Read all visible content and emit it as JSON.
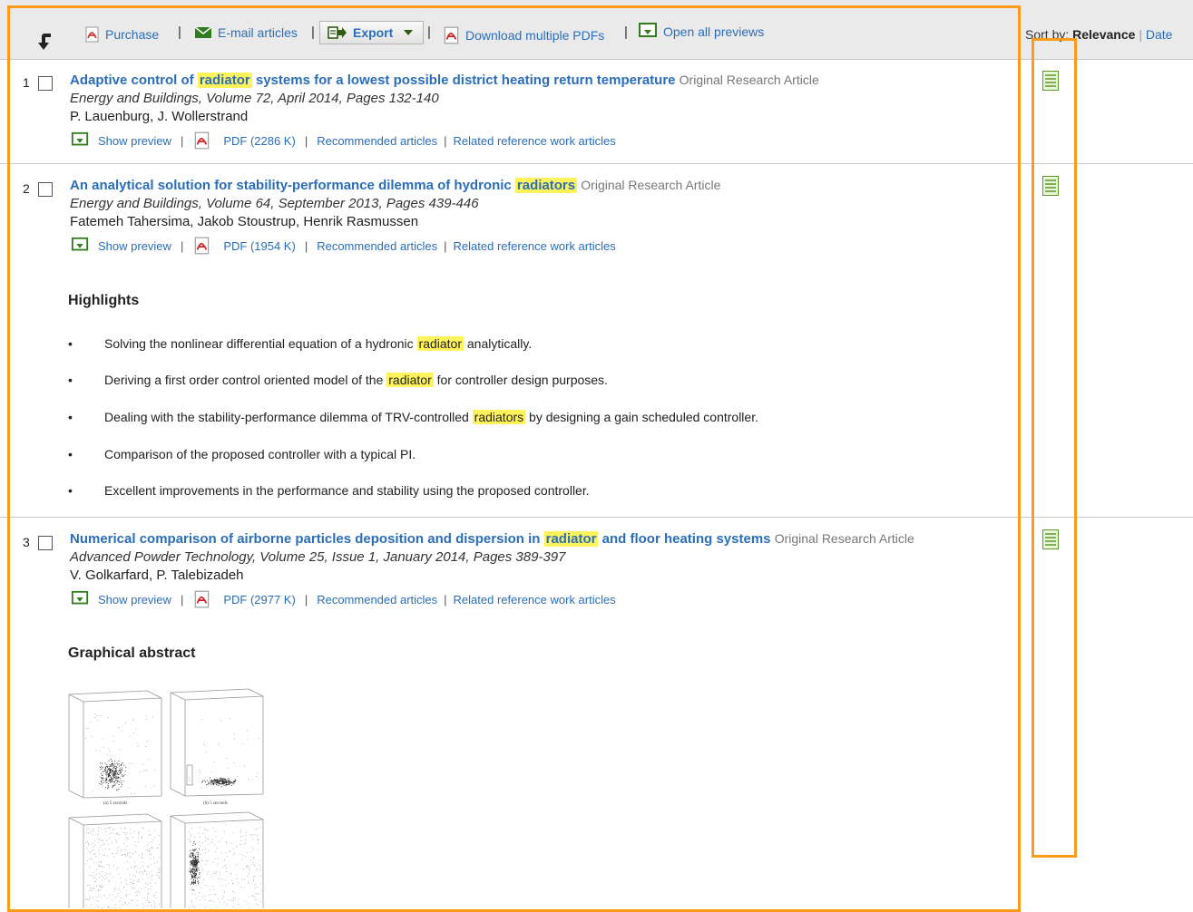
{
  "toolbar": {
    "purchase": "Purchase",
    "email": "E-mail articles",
    "export": "Export",
    "download_pdfs": "Download multiple PDFs",
    "open_previews": "Open all previews",
    "sort_label": "Sort by:",
    "sort_relevance": "Relevance",
    "sort_sep": "|",
    "sort_date": "Date"
  },
  "results": [
    {
      "num": "1",
      "title_pre": "Adaptive control of ",
      "title_hl": "radiator",
      "title_post": " systems for a lowest possible district heating return temperature",
      "type": "Original Research Article",
      "source": "Energy and Buildings, Volume 72, April 2014, Pages 132-140",
      "authors": "P. Lauenburg, J. Wollerstrand",
      "show_preview": "Show preview",
      "pdf": "PDF (2286 K)",
      "recommended": "Recommended articles",
      "related": "Related reference work articles"
    },
    {
      "num": "2",
      "title_pre": "An analytical solution for stability-performance dilemma of hydronic ",
      "title_hl": "radiators",
      "title_post": "",
      "type": "Original Research Article",
      "source": "Energy and Buildings, Volume 64, September 2013, Pages 439-446",
      "authors": "Fatemeh Tahersima, Jakob Stoustrup, Henrik Rasmussen",
      "show_preview": "Show preview",
      "pdf": "PDF (1954 K)",
      "recommended": "Recommended articles",
      "related": "Related reference work articles",
      "highlights_title": "Highlights",
      "highlights": [
        {
          "pre": "Solving the nonlinear differential equation of a hydronic ",
          "hl": "radiator",
          "post": " analytically."
        },
        {
          "pre": "Deriving a first order control oriented model of the ",
          "hl": "radiator",
          "post": " for controller design purposes."
        },
        {
          "pre": "Dealing with the stability-performance dilemma of TRV-controlled ",
          "hl": "radiators",
          "post": " by designing a gain scheduled controller."
        },
        {
          "pre": "Comparison of the proposed controller with a typical PI.",
          "hl": "",
          "post": ""
        },
        {
          "pre": "Excellent improvements in the performance and stability using the proposed controller.",
          "hl": "",
          "post": ""
        }
      ]
    },
    {
      "num": "3",
      "title_pre": "Numerical comparison of airborne particles deposition and dispersion in ",
      "title_hl": "radiator",
      "title_post": " and floor heating systems",
      "type": "Original Research Article",
      "source": "Advanced Powder Technology, Volume 25, Issue 1, January 2014, Pages 389-397",
      "authors": "V. Golkarfard, P. Talebizadeh",
      "show_preview": "Show preview",
      "pdf": "PDF (2977 K)",
      "recommended": "Recommended articles",
      "related": "Related reference work articles",
      "graphical_title": "Graphical abstract",
      "ga_captions": [
        "(a) 5 seconds",
        "(b) 5 seconds"
      ]
    }
  ],
  "colors": {
    "link": "#2a6ebb",
    "highlight": "#fff35c",
    "annotation": "#ff9a1a",
    "toolbar_bg": "#eaeaea"
  },
  "icons": [
    "back-arrow-icon",
    "pdf-icon",
    "email-icon",
    "export-icon",
    "preview-icon",
    "document-list-icon"
  ]
}
